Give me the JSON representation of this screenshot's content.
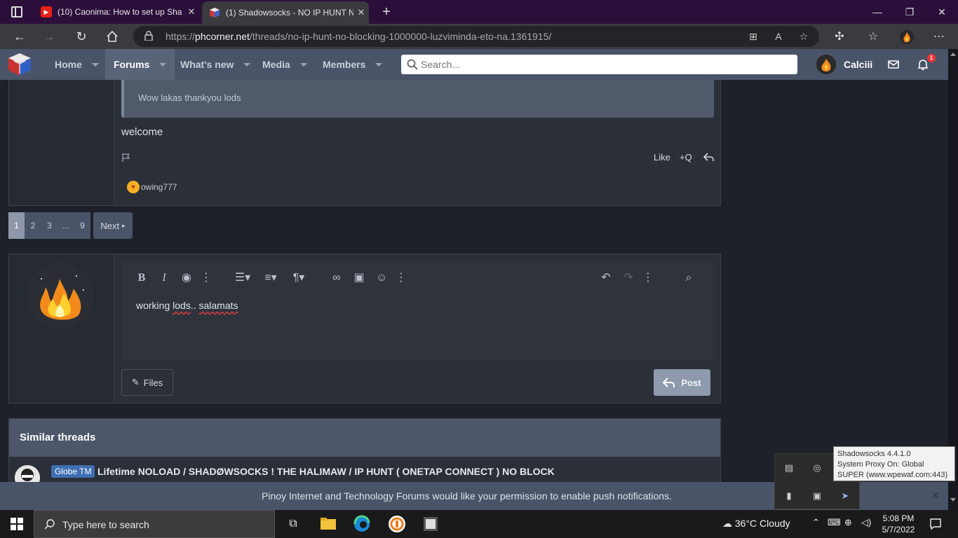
{
  "browser": {
    "tabs": [
      {
        "title": "(10) Caonima: How to set up Sha",
        "favicon": "youtube-icon"
      },
      {
        "title": "(1) Shadowsocks - NO IP HUNT N",
        "favicon": "phcorner-icon"
      }
    ],
    "new_tab": "+",
    "url_prefix": "https://",
    "url_domain": "phcorner.net",
    "url_path": "/threads/no-ip-hunt-no-blocking-1000000-luzviminda-eto-na.1361915/"
  },
  "site_nav": {
    "items": [
      {
        "label": "Home"
      },
      {
        "label": "Forums"
      },
      {
        "label": "What's new"
      },
      {
        "label": "Media"
      },
      {
        "label": "Members"
      }
    ],
    "search_placeholder": "Search...",
    "username": "Calciii",
    "alert_count": "1"
  },
  "post": {
    "quote_text": "Wow lakas thankyou lods",
    "body": "welcome",
    "like_label": "Like",
    "quote_label": "+Q",
    "reaction_user": "owing777"
  },
  "pagination": {
    "pages": [
      "1",
      "2",
      "3",
      "...",
      "9"
    ],
    "current": "1",
    "next_label": "Next"
  },
  "reply": {
    "editor_text_a": "working ",
    "editor_text_b": "lods",
    "editor_text_c": "..",
    "editor_text_d": " ",
    "editor_text_e": "salamats",
    "files_label": "Files",
    "post_label": "Post"
  },
  "similar": {
    "heading": "Similar threads",
    "threads": [
      {
        "prefix": "Globe TM",
        "title": "Lifetime NOLOAD / SHADØWSOCKS ! THE HALIMAW / IP HUNT ( ONETAP CONNECT ) NO BLOCK"
      }
    ]
  },
  "push_notice": "Pinoy Internet and Technology Forums would like your permission to enable push notifications.",
  "tooltip": {
    "line1": "Shadowsocks 4.4.1.0",
    "line2": "System Proxy On: Global",
    "line3": "SUPER (www.wpewaf.com:443)"
  },
  "taskbar": {
    "search_placeholder": "Type here to search",
    "weather": "36°C  Cloudy",
    "time": "5:08 PM",
    "date": "5/7/2022"
  },
  "colors": {
    "nav_bg": "#4a5468",
    "body_bg": "#1e2129",
    "tab_strip": "#2b0f3a",
    "post_button": "#8f9aae"
  }
}
